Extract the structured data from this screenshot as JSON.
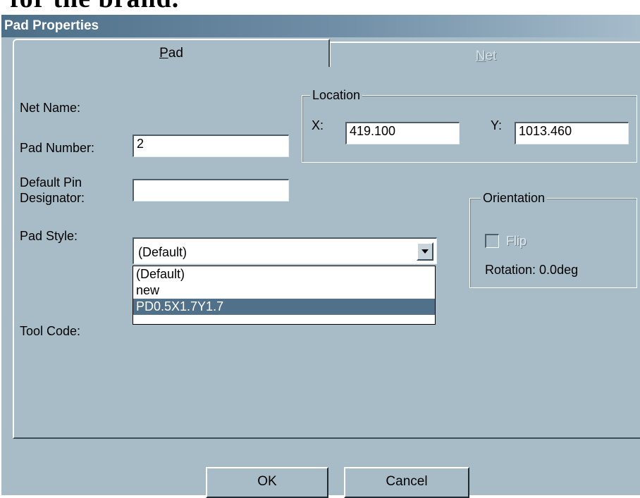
{
  "header_cut_text": "for the brand.",
  "dialog": {
    "title": "Pad Properties",
    "tabs": [
      {
        "label": "Pad",
        "mnemonic": "P",
        "rest": "ad",
        "active": true
      },
      {
        "label": "Net",
        "mnemonic": "N",
        "rest": "et",
        "active": false
      }
    ]
  },
  "form": {
    "net_name_label": "Net Name:",
    "pad_number_label": "Pad Number:",
    "pad_number_value": "2",
    "default_pin_label_line1": "Default Pin",
    "default_pin_label_line2": "Designator:",
    "default_pin_value": "",
    "pad_style_label": "Pad Style:",
    "pad_style_value": "(Default)",
    "pad_style_options": [
      "(Default)",
      "new",
      "PD0.5X1.7Y1.7"
    ],
    "pad_style_highlighted": "PD0.5X1.7Y1.7",
    "tool_code_label": "Tool Code:"
  },
  "location": {
    "title": "Location",
    "x_label": "X:",
    "x_value": "419.100",
    "y_label": "Y:",
    "y_value": "1013.460"
  },
  "orientation": {
    "title": "Orientation",
    "flip_label": "Flip",
    "flip_checked": false,
    "rotation_text": "Rotation: 0.0deg"
  },
  "buttons": {
    "ok": "OK",
    "cancel": "Cancel"
  },
  "colors": {
    "dialog_bg": "#a8bcc8",
    "titlebar_start": "#4c6e87",
    "selection": "#51708a"
  },
  "icons": {
    "dropdown_arrow": "chevron-down-icon"
  }
}
